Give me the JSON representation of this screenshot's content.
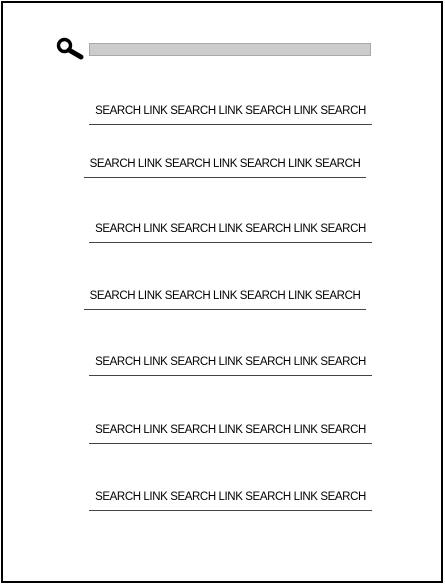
{
  "search": {
    "value": "",
    "icon": "magnifier-icon"
  },
  "results": [
    {
      "label": "SEARCH LINK SEARCH LINK SEARCH LINK SEARCH"
    },
    {
      "label": "SEARCH LINK SEARCH LINK SEARCH LINK SEARCH"
    },
    {
      "label": "SEARCH LINK SEARCH LINK SEARCH LINK SEARCH"
    },
    {
      "label": "SEARCH LINK SEARCH LINK SEARCH LINK SEARCH"
    },
    {
      "label": "SEARCH LINK SEARCH LINK SEARCH LINK SEARCH"
    },
    {
      "label": "SEARCH LINK SEARCH LINK SEARCH LINK SEARCH"
    },
    {
      "label": "SEARCH LINK SEARCH LINK SEARCH LINK SEARCH"
    }
  ],
  "colors": {
    "frame": "#000000",
    "input_fill": "#cccccc",
    "input_border": "#a9a9a9",
    "divider": "#444444",
    "text": "#000000"
  }
}
